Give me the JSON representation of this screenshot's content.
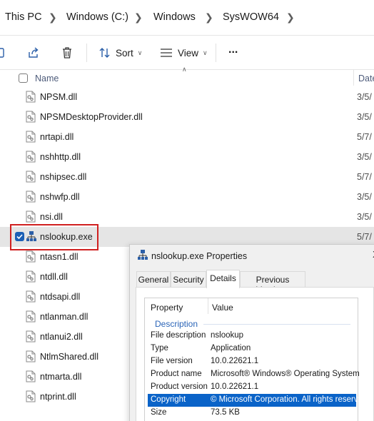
{
  "breadcrumb": {
    "items": [
      "This PC",
      "Windows (C:)",
      "Windows",
      "SysWOW64"
    ]
  },
  "toolbar": {
    "sort_label": "Sort",
    "view_label": "View",
    "more_label": "..."
  },
  "columns": {
    "name": "Name",
    "date": "Date"
  },
  "files": [
    {
      "name": "NPSM.dll",
      "date": "3/5/",
      "icon": "dll-file-icon"
    },
    {
      "name": "NPSMDesktopProvider.dll",
      "date": "3/5/",
      "icon": "dll-file-icon"
    },
    {
      "name": "nrtapi.dll",
      "date": "5/7/",
      "icon": "dll-file-icon"
    },
    {
      "name": "nshhttp.dll",
      "date": "3/5/",
      "icon": "dll-file-icon"
    },
    {
      "name": "nshipsec.dll",
      "date": "5/7/",
      "icon": "dll-file-icon"
    },
    {
      "name": "nshwfp.dll",
      "date": "3/5/",
      "icon": "dll-file-icon"
    },
    {
      "name": "nsi.dll",
      "date": "3/5/",
      "icon": "dll-file-icon"
    },
    {
      "name": "nslookup.exe",
      "date": "5/7/",
      "icon": "network-exe-icon",
      "selected": true
    },
    {
      "name": "ntasn1.dll",
      "date": "",
      "icon": "dll-file-icon"
    },
    {
      "name": "ntdll.dll",
      "date": "",
      "icon": "dll-file-icon"
    },
    {
      "name": "ntdsapi.dll",
      "date": "",
      "icon": "dll-file-icon"
    },
    {
      "name": "ntlanman.dll",
      "date": "",
      "icon": "dll-file-icon"
    },
    {
      "name": "ntlanui2.dll",
      "date": "",
      "icon": "dll-file-icon"
    },
    {
      "name": "NtlmShared.dll",
      "date": "",
      "icon": "dll-file-icon"
    },
    {
      "name": "ntmarta.dll",
      "date": "",
      "icon": "dll-file-icon"
    },
    {
      "name": "ntprint.dll",
      "date": "",
      "icon": "dll-file-icon"
    }
  ],
  "properties_dialog": {
    "title": "nslookup.exe Properties",
    "close_glyph": "X",
    "tabs": [
      "General",
      "Security",
      "Details",
      "Previous Versions"
    ],
    "active_tab": "Details",
    "header_property": "Property",
    "header_value": "Value",
    "group": "Description",
    "rows": [
      {
        "key": "File description",
        "value": "nslookup"
      },
      {
        "key": "Type",
        "value": "Application"
      },
      {
        "key": "File version",
        "value": "10.0.22621.1"
      },
      {
        "key": "Product name",
        "value": "Microsoft® Windows® Operating System"
      },
      {
        "key": "Product version",
        "value": "10.0.22621.1"
      },
      {
        "key": "Copyright",
        "value": "© Microsoft Corporation. All rights reserv...",
        "selected": true
      },
      {
        "key": "Size",
        "value": "73.5 KB"
      }
    ]
  },
  "colors": {
    "accent": "#0a63c8",
    "checkbox": "#1b5fb5",
    "highlight_border": "#d02020",
    "selected_row": "#e5e5e5"
  }
}
